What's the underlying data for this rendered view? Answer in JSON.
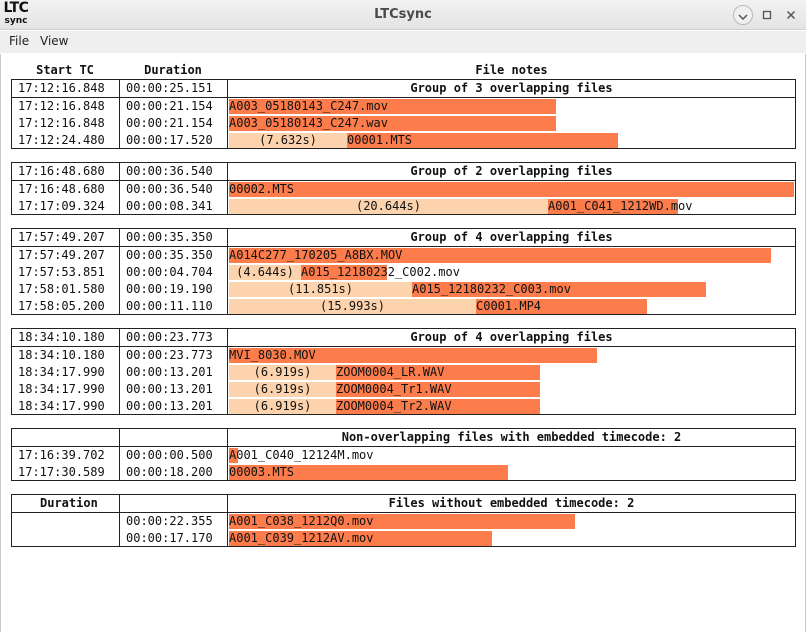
{
  "window": {
    "title": "LTCsync",
    "logo_line1": "LTC",
    "logo_line2": "sync",
    "minimize_icon": "minimize-icon",
    "maximize_icon": "maximize-icon",
    "close_icon": "close-icon"
  },
  "menu": {
    "file": "File",
    "view": "View"
  },
  "columns": {
    "start": "Start TC",
    "duration": "Duration",
    "notes": "File notes"
  },
  "groups": [
    {
      "header": "Group of 3 overlapping files",
      "start": "17:12:16.848",
      "duration": "00:00:25.151",
      "rows": [
        {
          "start": "17:12:16.848",
          "duration": "00:00:21.154",
          "offset": "",
          "file": "A003_05180143_C247.mov"
        },
        {
          "start": "17:12:16.848",
          "duration": "00:00:21.154",
          "offset": "",
          "file": "A003_05180143_C247.wav"
        },
        {
          "start": "17:12:24.480",
          "duration": "00:00:17.520",
          "offset": "(7.632s)",
          "file": "00001.MTS"
        }
      ]
    },
    {
      "header": "Group of 2 overlapping files",
      "start": "17:16:48.680",
      "duration": "00:00:36.540",
      "rows": [
        {
          "start": "17:16:48.680",
          "duration": "00:00:36.540",
          "offset": "",
          "file": "00002.MTS"
        },
        {
          "start": "17:17:09.324",
          "duration": "00:00:08.341",
          "offset": "(20.644s)",
          "file": "A001_C041_1212WD.mov"
        }
      ]
    },
    {
      "header": "Group of 4 overlapping files",
      "start": "17:57:49.207",
      "duration": "00:00:35.350",
      "rows": [
        {
          "start": "17:57:49.207",
          "duration": "00:00:35.350",
          "offset": "",
          "file": "A014C277_170205_A8BX.MOV"
        },
        {
          "start": "17:57:53.851",
          "duration": "00:00:04.704",
          "offset": "(4.644s)",
          "file": "A015_12180232_C002.mov"
        },
        {
          "start": "17:58:01.580",
          "duration": "00:00:19.190",
          "offset": "(11.851s)",
          "file": "A015_12180232_C003.mov"
        },
        {
          "start": "17:58:05.200",
          "duration": "00:00:11.110",
          "offset": "(15.993s)",
          "file": "C0001.MP4"
        }
      ]
    },
    {
      "header": "Group of 4 overlapping files",
      "start": "18:34:10.180",
      "duration": "00:00:23.773",
      "rows": [
        {
          "start": "18:34:10.180",
          "duration": "00:00:23.773",
          "offset": "",
          "file": "MVI_8030.MOV"
        },
        {
          "start": "18:34:17.990",
          "duration": "00:00:13.201",
          "offset": "(6.919s)",
          "file": "ZOOM0004_LR.WAV"
        },
        {
          "start": "18:34:17.990",
          "duration": "00:00:13.201",
          "offset": "(6.919s)",
          "file": "ZOOM0004_Tr1.WAV"
        },
        {
          "start": "18:34:17.990",
          "duration": "00:00:13.201",
          "offset": "(6.919s)",
          "file": "ZOOM0004_Tr2.WAV"
        }
      ]
    },
    {
      "header": "Non-overlapping files with embedded timecode: 2",
      "start": "",
      "duration": "",
      "rows": [
        {
          "start": "17:16:39.702",
          "duration": "00:00:00.500",
          "offset": "",
          "file": "A001_C040_12124M.mov"
        },
        {
          "start": "17:17:30.589",
          "duration": "00:00:18.200",
          "offset": "",
          "file": "00003.MTS"
        }
      ]
    },
    {
      "header": "Files without embedded timecode: 2",
      "start": "",
      "duration": "Duration",
      "rows": [
        {
          "start": "",
          "duration": "00:00:22.355",
          "offset": "",
          "file": "A001_C038_1212Q0.mov"
        },
        {
          "start": "",
          "duration": "00:00:17.170",
          "offset": "",
          "file": "A001_C039_1212AV.mov"
        }
      ]
    }
  ]
}
